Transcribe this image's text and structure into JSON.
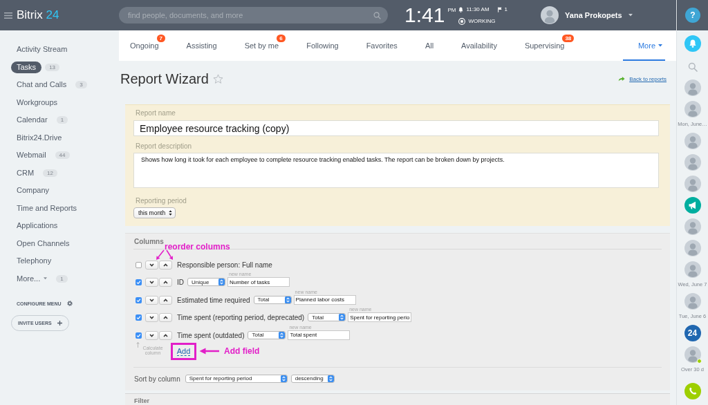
{
  "header": {
    "logo": {
      "name": "Bitrix",
      "number": "24"
    },
    "search": {
      "placeholder": "find people, documents, and more"
    },
    "clock": {
      "time": "1:41",
      "period": "PM"
    },
    "alarm": "11:30 AM",
    "flags": "1",
    "status": "WORKING",
    "user": {
      "name": "Yana Prokopets"
    },
    "help": "?"
  },
  "sidebar": {
    "items": [
      {
        "label": "Activity Stream",
        "kind": "link",
        "selected": false
      },
      {
        "label": "Tasks",
        "count": "13",
        "kind": "link",
        "selected": true
      },
      {
        "label": "Chat and Calls",
        "count": "3",
        "kind": "link",
        "selected": false
      },
      {
        "label": "Workgroups",
        "kind": "link",
        "selected": false
      },
      {
        "label": "Calendar",
        "count": "1",
        "kind": "link",
        "selected": false
      },
      {
        "label": "Bitrix24.Drive",
        "kind": "link",
        "selected": false
      },
      {
        "label": "Webmail",
        "count": "44",
        "kind": "link",
        "selected": false
      },
      {
        "label": "CRM",
        "count": "12",
        "kind": "link",
        "selected": false
      },
      {
        "label": "Company",
        "kind": "link",
        "selected": false
      },
      {
        "label": "Time and Reports",
        "kind": "link",
        "selected": false
      },
      {
        "label": "Applications",
        "kind": "link",
        "selected": false
      },
      {
        "label": "Open Channels",
        "kind": "link",
        "selected": false
      },
      {
        "label": "Telephony",
        "kind": "link",
        "selected": false
      },
      {
        "label": "More...",
        "count": "1",
        "kind": "dropdown",
        "selected": false
      }
    ],
    "configure": "CONFIGURE MENU",
    "invite": "INVITE USERS"
  },
  "tabs": [
    {
      "label": "Ongoing",
      "badge": "7",
      "kind": "tab",
      "selected": false
    },
    {
      "label": "Assisting",
      "kind": "tab",
      "selected": false
    },
    {
      "label": "Set by me",
      "badge": "6",
      "kind": "tab",
      "selected": false
    },
    {
      "label": "Following",
      "kind": "tab",
      "selected": false
    },
    {
      "label": "Favorites",
      "kind": "tab",
      "selected": false
    },
    {
      "label": "All",
      "kind": "tab",
      "selected": false
    },
    {
      "label": "Availability",
      "kind": "tab",
      "selected": false
    },
    {
      "label": "Supervising",
      "badge": "38",
      "kind": "tab",
      "selected": false
    },
    {
      "label": "More",
      "kind": "dropdown",
      "selected": true
    }
  ],
  "page": {
    "title": "Report Wizard",
    "starred": false,
    "back_link": "Back to reports"
  },
  "report_form": {
    "name": {
      "label": "Report name",
      "value": "Employee resource tracking (copy)"
    },
    "description": {
      "label": "Report description",
      "value": "Shows how long it took for each employee to complete resource tracking enabled tasks. The report can be broken down by projects."
    },
    "period": {
      "label": "Reporting period",
      "value": "this month"
    }
  },
  "columns_section": {
    "title": "Columns",
    "rows": [
      {
        "label": "Responsible person: Full name",
        "checked": false
      },
      {
        "label": "ID",
        "checked": true,
        "aggregate": "Unique",
        "new_name_label": "new name",
        "new_name": "Number of tasks"
      },
      {
        "label": "Estimated time required",
        "checked": true,
        "aggregate": "Total",
        "new_name_label": "new name",
        "new_name": "Planned labor costs"
      },
      {
        "label": "Time spent (reporting period, deprecated)",
        "checked": true,
        "aggregate": "Total",
        "new_name_label": "new name",
        "new_name": "Spent for reporting perio"
      },
      {
        "label": "Time spent (outdated)",
        "checked": true,
        "aggregate": "Total",
        "new_name_label": "new name",
        "new_name": "Total spent"
      }
    ],
    "calculate_hint": "Calculate column",
    "add_link": "Add",
    "sort": {
      "label": "Sort by column",
      "column": "Spent for reporting period",
      "order": "descending"
    }
  },
  "annotations": {
    "reorder": "reorder columns",
    "add": "Add field"
  },
  "filter_section": {
    "title": "Filter"
  },
  "right_panel": {
    "items": [
      {
        "kind": "bell"
      },
      {
        "kind": "search"
      },
      {
        "kind": "avatar",
        "online": false
      },
      {
        "kind": "avatar",
        "online": false
      },
      {
        "kind": "date",
        "label": "Mon, June…"
      },
      {
        "kind": "avatar",
        "online": false
      },
      {
        "kind": "avatar",
        "online": false
      },
      {
        "kind": "avatar",
        "online": false
      },
      {
        "kind": "channel"
      },
      {
        "kind": "avatar",
        "online": false
      },
      {
        "kind": "avatar",
        "online": false
      },
      {
        "kind": "avatar",
        "online": false
      },
      {
        "kind": "date",
        "label": "Wed, June 7"
      },
      {
        "kind": "avatar",
        "online": false
      },
      {
        "kind": "date",
        "label": "Tue, June 6"
      },
      {
        "kind": "app",
        "label": "24"
      },
      {
        "kind": "avatar",
        "online": true
      },
      {
        "kind": "date",
        "label": "Over 30 d"
      },
      {
        "kind": "phone"
      }
    ]
  }
}
